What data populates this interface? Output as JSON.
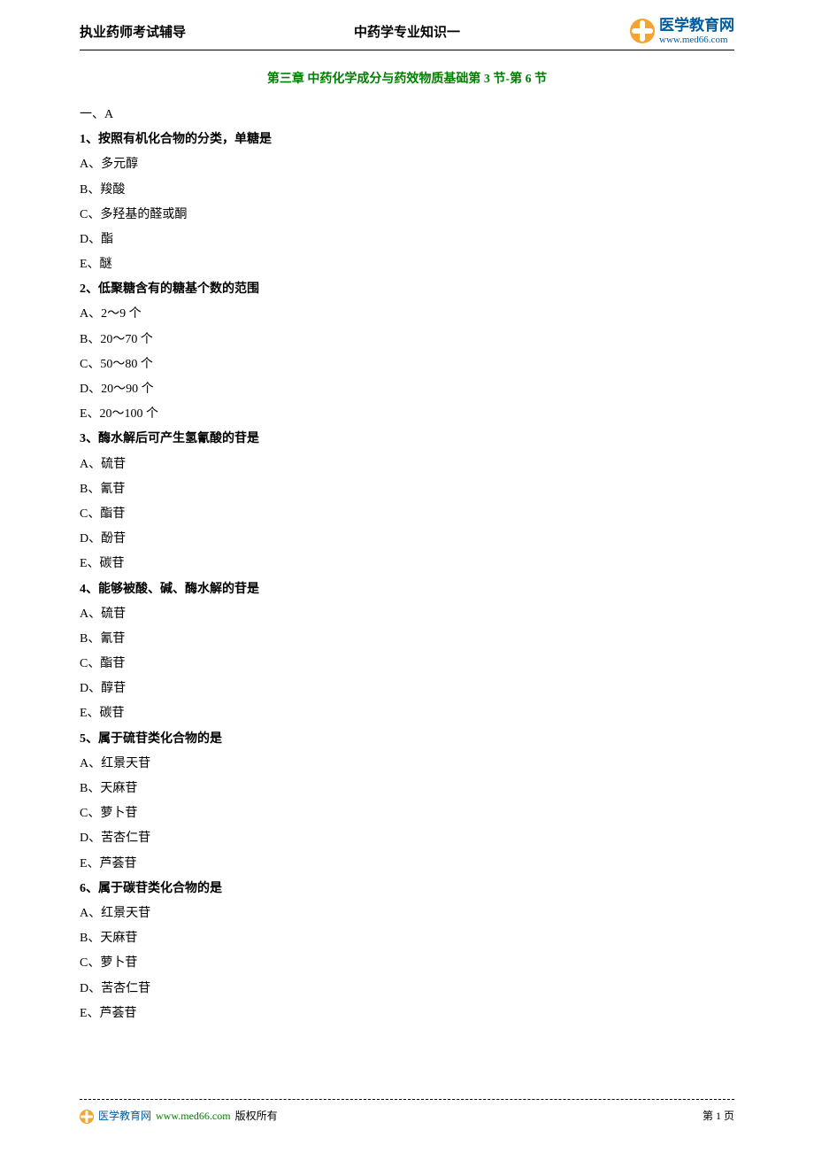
{
  "header": {
    "left": "执业药师考试辅导",
    "center": "中药学专业知识一",
    "logo_cn": "医学教育网",
    "logo_en": "www.med66.com"
  },
  "chapter_title": "第三章 中药化学成分与药效物质基础第 3 节-第 6 节",
  "section_label": "一、A",
  "questions": [
    {
      "stem": "1、按照有机化合物的分类，单糖是",
      "options": [
        "A、多元醇",
        "B、羧酸",
        "C、多羟基的醛或酮",
        "D、酯",
        "E、醚"
      ]
    },
    {
      "stem": "2、低聚糖含有的糖基个数的范围",
      "options": [
        "A、2～9 个",
        "B、20～70 个",
        "C、50～80 个",
        "D、20～90 个",
        "E、20～100 个"
      ]
    },
    {
      "stem": "3、酶水解后可产生氢氰酸的苷是",
      "options": [
        "A、硫苷",
        "B、氰苷",
        "C、酯苷",
        "D、酚苷",
        "E、碳苷"
      ]
    },
    {
      "stem": "4、能够被酸、碱、酶水解的苷是",
      "options": [
        "A、硫苷",
        "B、氰苷",
        "C、酯苷",
        "D、醇苷",
        "E、碳苷"
      ]
    },
    {
      "stem": "5、属于硫苷类化合物的是",
      "options": [
        "A、红景天苷",
        "B、天麻苷",
        "C、萝卜苷",
        "D、苦杏仁苷",
        "E、芦荟苷"
      ]
    },
    {
      "stem": "6、属于碳苷类化合物的是",
      "options": [
        "A、红景天苷",
        "B、天麻苷",
        "C、萝卜苷",
        "D、苦杏仁苷",
        "E、芦荟苷"
      ]
    }
  ],
  "footer": {
    "brand": "医学教育网",
    "url": "www.med66.com",
    "copyright": "版权所有",
    "page": "第 1 页"
  }
}
